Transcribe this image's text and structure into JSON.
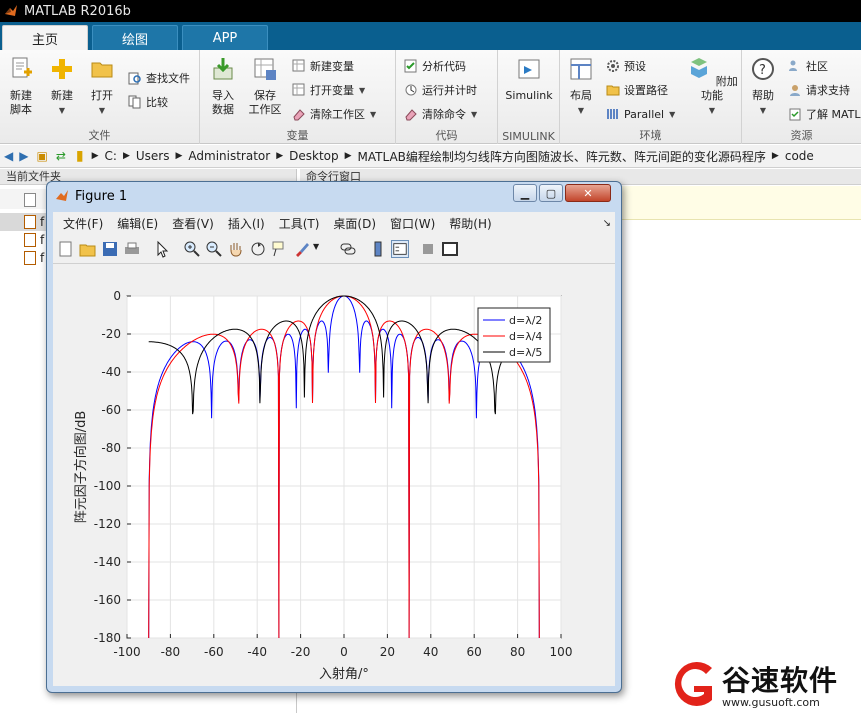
{
  "app": {
    "title": "MATLAB R2016b"
  },
  "tabs": [
    {
      "label": "主页"
    },
    {
      "label": "绘图"
    },
    {
      "label": "APP"
    }
  ],
  "ribbon": {
    "file": {
      "caption": "文件",
      "new_script": "新建\n脚本",
      "new": "新建",
      "open": "打开",
      "find_files": "查找文件",
      "compare": "比较"
    },
    "variable": {
      "caption": "变量",
      "import": "导入\n数据",
      "save_ws": "保存\n工作区",
      "new_var": "新建变量",
      "open_var": "打开变量",
      "clear_ws": "清除工作区"
    },
    "code": {
      "caption": "代码",
      "analyze": "分析代码",
      "run_time": "运行并计时",
      "clear_cmd": "清除命令"
    },
    "simulink": {
      "caption": "SIMULINK",
      "label": "Simulink"
    },
    "env": {
      "caption": "环境",
      "layout": "布局",
      "prefs": "预设",
      "set_path": "设置路径",
      "parallel": "Parallel",
      "addons": "附加功能"
    },
    "resources": {
      "caption": "资源",
      "help": "帮助",
      "community": "社区",
      "support": "请求支持",
      "learn": "了解 MATLAB"
    }
  },
  "address": {
    "crumbs": [
      "C:",
      "Users",
      "Administrator",
      "Desktop",
      "MATLAB编程绘制均匀线阵方向图随波长、阵元数、阵元间距的变化源码程序",
      "code"
    ]
  },
  "left_pane": {
    "title": "当前文件夹",
    "files": [
      "f",
      "f",
      "f"
    ]
  },
  "right_pane": {
    "title": "命令行窗口"
  },
  "figure": {
    "title": "Figure 1",
    "menus": [
      "文件(F)",
      "编辑(E)",
      "查看(V)",
      "插入(I)",
      "工具(T)",
      "桌面(D)",
      "窗口(W)",
      "帮助(H)"
    ],
    "toolbar_icons": [
      "new-figure-icon",
      "open-icon",
      "save-icon",
      "print-icon",
      "pointer-icon",
      "zoom-in-icon",
      "zoom-out-icon",
      "pan-icon",
      "rotate-icon",
      "data-cursor-icon",
      "brush-icon",
      "link-icon",
      "colorbar-icon",
      "legend-icon",
      "hide-tools-icon",
      "show-tools-icon"
    ]
  },
  "chart_data": {
    "type": "line",
    "title": "",
    "xlabel": "入射角/°",
    "ylabel": "阵元因子方向图/dB",
    "xlim": [
      -100,
      100
    ],
    "ylim": [
      -180,
      0
    ],
    "xticks": [
      -100,
      -80,
      -60,
      -40,
      -20,
      0,
      20,
      40,
      60,
      80,
      100
    ],
    "yticks": [
      0,
      -20,
      -40,
      -60,
      -80,
      -100,
      -120,
      -140,
      -160,
      -180
    ],
    "grid": true,
    "legend_position": "top-right",
    "series": [
      {
        "name": "d=λ/2",
        "color": "#0000ff",
        "spacing": 0.5
      },
      {
        "name": "d=λ/4",
        "color": "#ff0000",
        "spacing": 0.25
      },
      {
        "name": "d=λ/5",
        "color": "#000000",
        "spacing": 0.2
      }
    ]
  },
  "watermark": {
    "text": "谷速软件",
    "url": "www.gusuoft.com"
  }
}
